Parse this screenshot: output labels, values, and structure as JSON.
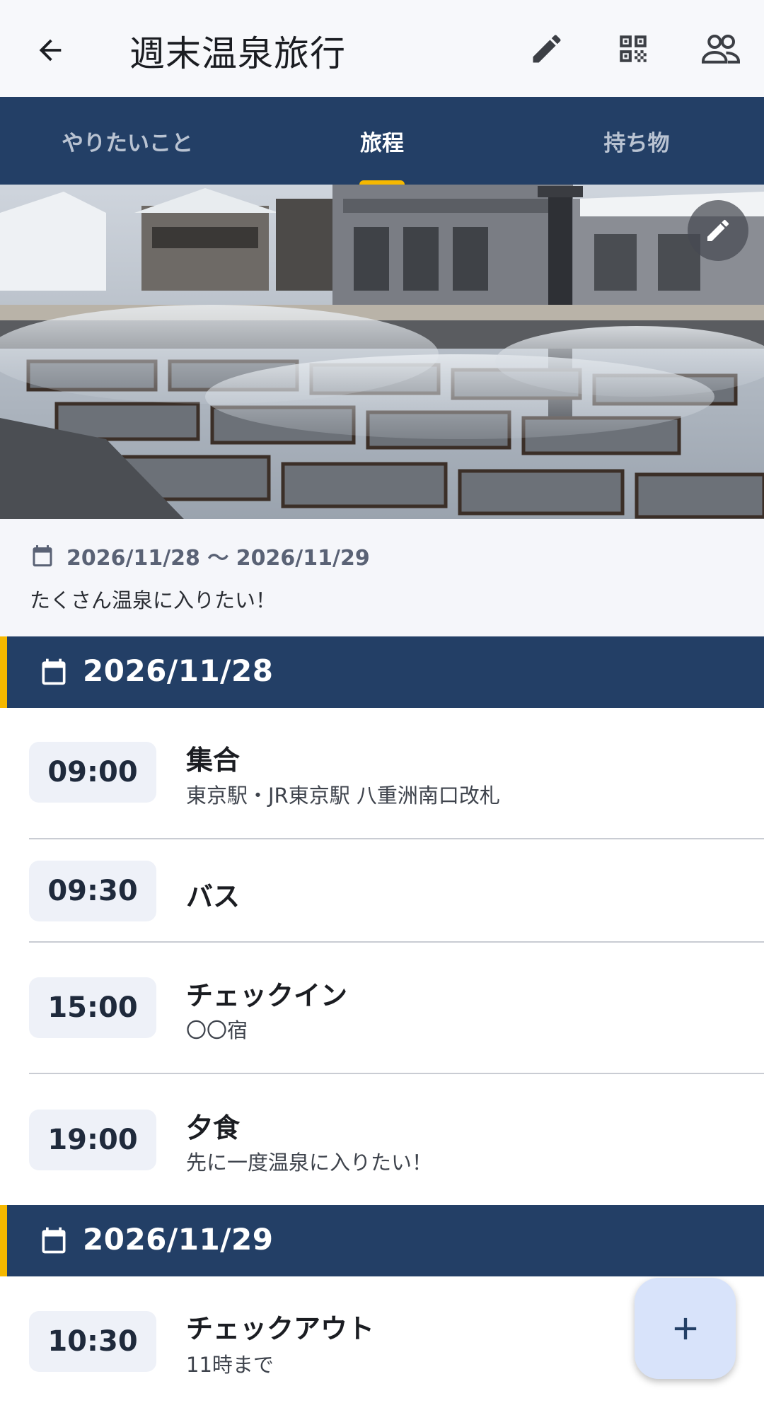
{
  "app_bar": {
    "title": "週末温泉旅行",
    "back_icon": "arrow-back-icon",
    "actions": [
      "edit-icon",
      "qr-code-icon",
      "people-icon"
    ]
  },
  "tabs": [
    {
      "label": "やりたいこと",
      "active": false
    },
    {
      "label": "旅程",
      "active": true
    },
    {
      "label": "持ち物",
      "active": false
    }
  ],
  "colors": {
    "primary": "#233f66",
    "accent": "#f5b800",
    "fab": "#d8e3fa",
    "time_chip": "#eef1f8"
  },
  "trip": {
    "date_range": "2026/11/28 〜 2026/11/29",
    "description": "たくさん温泉に入りたい！"
  },
  "days": [
    {
      "date": "2026/11/28",
      "items": [
        {
          "time": "09:00",
          "title": "集合",
          "subtitle": "東京駅・JR東京駅 八重洲南口改札"
        },
        {
          "time": "09:30",
          "title": "バス",
          "subtitle": ""
        },
        {
          "time": "15:00",
          "title": "チェックイン",
          "subtitle": "〇〇宿"
        },
        {
          "time": "19:00",
          "title": "夕食",
          "subtitle": "先に一度温泉に入りたい！"
        }
      ]
    },
    {
      "date": "2026/11/29",
      "items": [
        {
          "time": "10:30",
          "title": "チェックアウト",
          "subtitle": "11時まで"
        }
      ]
    }
  ],
  "fab": {
    "icon": "plus-icon"
  }
}
